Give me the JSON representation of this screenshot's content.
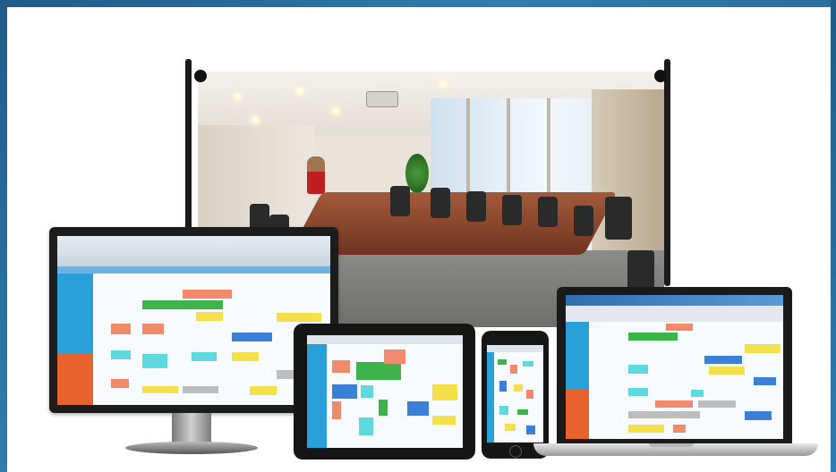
{
  "scene": {
    "description_items": [],
    "colors": {
      "frame_blue": "#2f7db0",
      "resource_column_blue": "#2aa0d8",
      "resource_column_orange": "#e8622e",
      "event_green": "#3cb44a",
      "event_yellow": "#f4e04a",
      "event_cyan": "#5fd9e0",
      "event_salmon": "#f08a6a",
      "event_blue": "#3a7fd8",
      "event_gray": "#bdbdbd"
    }
  },
  "devices": {
    "monitor": {
      "app": "calendar-scheduler"
    },
    "tablet": {
      "app": "calendar-scheduler"
    },
    "phone": {
      "app": "calendar-scheduler"
    },
    "laptop": {
      "app": "calendar-scheduler"
    }
  },
  "projection_screen": {
    "content": "conference-room-photo"
  }
}
